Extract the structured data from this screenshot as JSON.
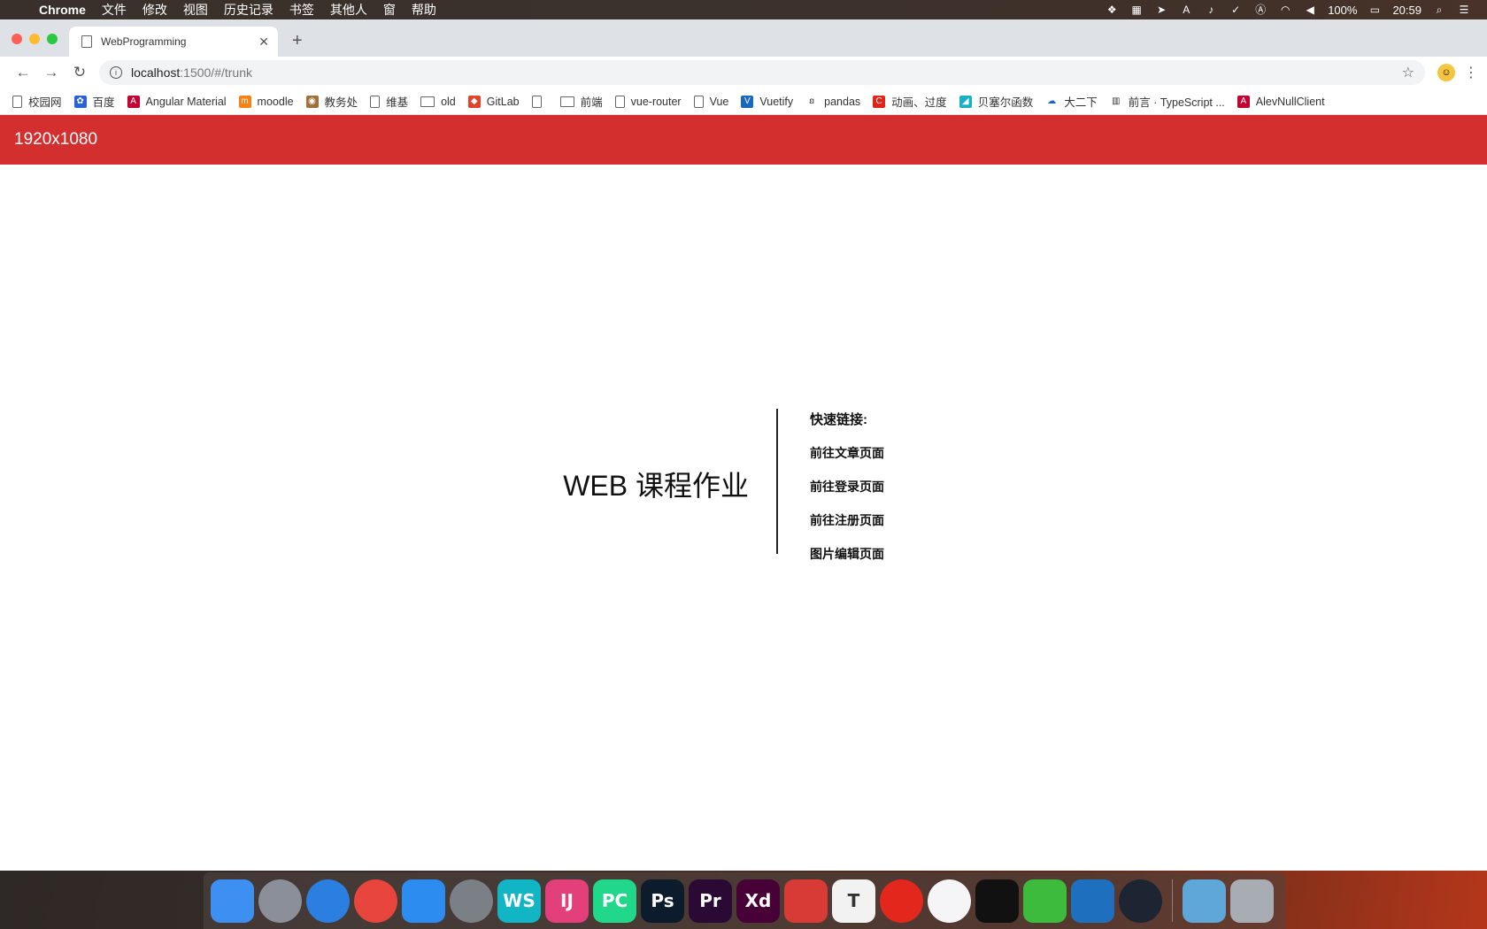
{
  "menubar": {
    "app_name": "Chrome",
    "menus": [
      "文件",
      "修改",
      "视图",
      "历史记录",
      "书签",
      "其他人",
      "窗",
      "帮助"
    ],
    "battery": "100%",
    "time": "20:59"
  },
  "browser": {
    "tab_title": "WebProgramming",
    "url_host": "localhost",
    "url_path": ":1500/#/trunk",
    "bookmarks": [
      {
        "label": "校园网",
        "icon": "doc-icon"
      },
      {
        "label": "百度",
        "icon": "baidu-icon"
      },
      {
        "label": "Angular Material",
        "icon": "angular-icon"
      },
      {
        "label": "moodle",
        "icon": "moodle-icon"
      },
      {
        "label": "教务处",
        "icon": "school-icon"
      },
      {
        "label": "维基",
        "icon": "doc-icon"
      },
      {
        "label": "old",
        "icon": "folder-icon"
      },
      {
        "label": "GitLab",
        "icon": "gitlab-icon"
      },
      {
        "label": "",
        "icon": "doc-icon"
      },
      {
        "label": "前端",
        "icon": "folder-icon"
      },
      {
        "label": "vue-router",
        "icon": "doc-icon"
      },
      {
        "label": "Vue",
        "icon": "doc-icon"
      },
      {
        "label": "Vuetify",
        "icon": "vuetify-icon"
      },
      {
        "label": "pandas",
        "icon": "pandas-icon"
      },
      {
        "label": "动画、过度",
        "icon": "red-c-icon"
      },
      {
        "label": "贝塞尔函数",
        "icon": "teal-icon"
      },
      {
        "label": "大二下",
        "icon": "cloud-icon"
      },
      {
        "label": "前言 · TypeScript ...",
        "icon": "book-icon"
      },
      {
        "label": "AlevNullClient",
        "icon": "angular-icon"
      }
    ]
  },
  "app": {
    "bar_title": "1920x1080",
    "hero_title": "WEB 课程作业",
    "links_heading": "快速链接:",
    "links": [
      "前往文章页面",
      "前往登录页面",
      "前往注册页面",
      "图片编辑页面"
    ]
  },
  "dock": {
    "apps": [
      {
        "name": "finder",
        "label": "",
        "color": "#3d8ff2"
      },
      {
        "name": "launchpad",
        "label": "",
        "color": "#8a8f99"
      },
      {
        "name": "safari",
        "label": "",
        "color": "#2a7fe0"
      },
      {
        "name": "chrome",
        "label": "",
        "color": "#e8453c"
      },
      {
        "name": "app-store",
        "label": "",
        "color": "#2d8cf0"
      },
      {
        "name": "system-preferences",
        "label": "",
        "color": "#7b7f86"
      },
      {
        "name": "webstorm",
        "label": "WS",
        "color": "#12b5c4"
      },
      {
        "name": "intellij",
        "label": "IJ",
        "color": "#e33f7a"
      },
      {
        "name": "pycharm",
        "label": "PC",
        "color": "#21d789"
      },
      {
        "name": "photoshop",
        "label": "Ps",
        "color": "#0c1c2c"
      },
      {
        "name": "premiere",
        "label": "Pr",
        "color": "#2a0a34"
      },
      {
        "name": "xd",
        "label": "Xd",
        "color": "#470137"
      },
      {
        "name": "bear",
        "label": "",
        "color": "#d83a36"
      },
      {
        "name": "typora",
        "label": "T",
        "color": "#f2f2f2"
      },
      {
        "name": "netease-music",
        "label": "",
        "color": "#e4271c"
      },
      {
        "name": "itunes",
        "label": "",
        "color": "#f5f5f7"
      },
      {
        "name": "qq",
        "label": "",
        "color": "#111111"
      },
      {
        "name": "wechat",
        "label": "",
        "color": "#3dbb3d"
      },
      {
        "name": "vscode",
        "label": "",
        "color": "#1f6fbf"
      },
      {
        "name": "infuse",
        "label": "",
        "color": "#1d2532"
      },
      {
        "name": "downloads",
        "label": "",
        "color": "#5fa7d8"
      },
      {
        "name": "trash",
        "label": "",
        "color": "#a8adb3"
      }
    ]
  }
}
